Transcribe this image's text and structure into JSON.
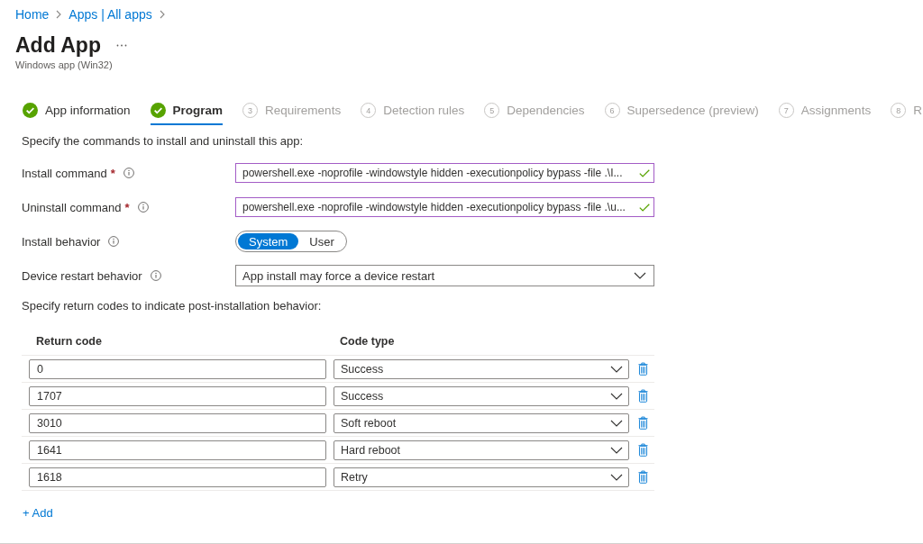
{
  "breadcrumb": [
    "Home",
    "Apps | All apps"
  ],
  "header": {
    "title": "Add App",
    "subtitle": "Windows app (Win32)"
  },
  "tabs": [
    {
      "label": "App information",
      "selected": false,
      "completed": true
    },
    {
      "label": "Program",
      "selected": true,
      "completed": true
    },
    {
      "label": "Requirements",
      "selected": false,
      "completed": false,
      "number": "3"
    },
    {
      "label": "Detection rules",
      "selected": false,
      "completed": false,
      "number": "4"
    },
    {
      "label": "Dependencies",
      "selected": false,
      "completed": false,
      "number": "5"
    },
    {
      "label": "Supersedence (preview)",
      "selected": false,
      "completed": false,
      "number": "6"
    },
    {
      "label": "Assignments",
      "selected": false,
      "completed": false,
      "number": "7"
    },
    {
      "label": "R",
      "selected": false,
      "completed": false,
      "number": "8"
    }
  ],
  "form": {
    "intro": "Specify the commands to install and uninstall this app:",
    "fields": [
      {
        "kind": "text",
        "label": "Install command",
        "required_mark": "*",
        "info": true,
        "value": "powershell.exe -noprofile -windowstyle hidden -executionpolicy bypass -file .\\I...",
        "valid": true
      },
      {
        "kind": "text",
        "label": "Uninstall command",
        "required_mark": "*",
        "info": true,
        "value": "powershell.exe -noprofile -windowstyle hidden -executionpolicy bypass -file .\\u...",
        "valid": true
      },
      {
        "kind": "toggle",
        "label": "Install behavior",
        "info": true,
        "options": [
          {
            "label": "System",
            "selected": true
          },
          {
            "label": "User",
            "selected": false
          }
        ]
      },
      {
        "kind": "dropdown",
        "label": "Device restart behavior",
        "info": true,
        "value": "App install may force a device restart"
      }
    ]
  },
  "return_codes": {
    "intro": "Specify return codes to indicate post-installation behavior:",
    "columns": [
      "Return code",
      "Code type"
    ],
    "rows": [
      {
        "code": "0",
        "type": "Success"
      },
      {
        "code": "1707",
        "type": "Success"
      },
      {
        "code": "3010",
        "type": "Soft reboot"
      },
      {
        "code": "1641",
        "type": "Hard reboot"
      },
      {
        "code": "1618",
        "type": "Retry"
      }
    ],
    "add_label": "+ Add"
  }
}
